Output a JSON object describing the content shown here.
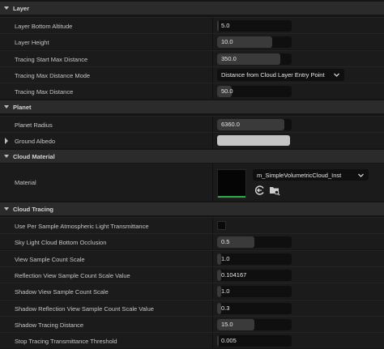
{
  "sections": {
    "layer": "Layer",
    "planet": "Planet",
    "cloud_material": "Cloud Material",
    "cloud_tracing": "Cloud Tracing"
  },
  "layer": {
    "bottom_altitude": {
      "label": "Layer Bottom Altitude",
      "value": "5.0",
      "fill": 0.02
    },
    "height": {
      "label": "Layer Height",
      "value": "10.0",
      "fill": 0.74
    },
    "tracing_start_max_distance": {
      "label": "Tracing Start Max Distance",
      "value": "350.0",
      "fill": 0.85
    },
    "tracing_max_distance_mode": {
      "label": "Tracing Max Distance Mode",
      "value": "Distance from Cloud Layer Entry Point"
    },
    "tracing_max_distance": {
      "label": "Tracing Max Distance",
      "value": "50.0",
      "fill": 0.2
    }
  },
  "planet": {
    "radius": {
      "label": "Planet Radius",
      "value": "6360.0",
      "fill": 0.9
    },
    "ground_albedo": {
      "label": "Ground Albedo",
      "color": "#c5c5c5"
    }
  },
  "material": {
    "label": "Material",
    "value": "m_SimpleVolumetricCloud_Inst"
  },
  "tracing": {
    "per_sample_atmo": {
      "label": "Use Per Sample Atmospheric Light Transmittance",
      "checked": false
    },
    "sky_light_occlusion": {
      "label": "Sky Light Cloud Bottom Occlusion",
      "value": "0.5",
      "fill": 0.5
    },
    "view_sample_scale": {
      "label": "View Sample Count Scale",
      "value": "1.0",
      "fill": 0.05
    },
    "reflection_view_scale": {
      "label": "Reflection View Sample Count Scale Value",
      "value": "0.104167",
      "fill": 0.05
    },
    "shadow_view_scale": {
      "label": "Shadow View Sample Count Scale",
      "value": "1.0",
      "fill": 0.05
    },
    "shadow_reflection_view_scale": {
      "label": "Shadow Reflection View Sample Count Scale Value",
      "value": "0.3",
      "fill": 0.05
    },
    "shadow_tracing_distance": {
      "label": "Shadow Tracing Distance",
      "value": "15.0",
      "fill": 0.5
    },
    "stop_tracing_threshold": {
      "label": "Stop Tracing Transmittance Threshold",
      "value": "0.005",
      "fill": 0.02
    }
  },
  "icons": {
    "expanded": "chevron-down-icon",
    "collapsed": "chevron-right-icon",
    "use_selected": "arrow-left-circle-icon",
    "browse": "folder-search-icon"
  },
  "colors": {
    "accent_green": "#2ea84a",
    "section_bg": "#2b2b2b",
    "row_bg": "#1b1b1b"
  }
}
